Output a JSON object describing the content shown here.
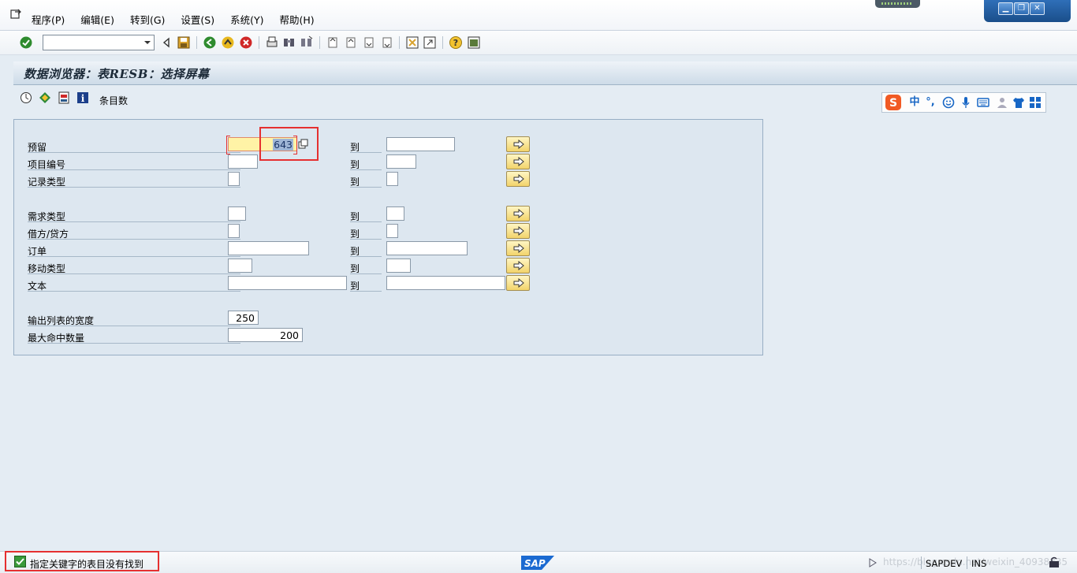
{
  "menu": {
    "items": [
      "程序(P)",
      "编辑(E)",
      "转到(G)",
      "设置(S)",
      "系统(Y)",
      "帮助(H)"
    ]
  },
  "toolbar": {
    "command_field_value": ""
  },
  "header": {
    "title": "数据浏览器：表RESB：选择屏幕"
  },
  "app_toolbar": {
    "entries_label": "条目数"
  },
  "selection": {
    "to_label": "到",
    "fields": [
      {
        "label": "预留",
        "from": "643",
        "to": ""
      },
      {
        "label": "项目编号",
        "from": "",
        "to": ""
      },
      {
        "label": "记录类型",
        "from": "",
        "to": ""
      },
      {
        "label": "需求类型",
        "from": "",
        "to": ""
      },
      {
        "label": "借方/贷方",
        "from": "",
        "to": ""
      },
      {
        "label": "订单",
        "from": "",
        "to": ""
      },
      {
        "label": "移动类型",
        "from": "",
        "to": ""
      },
      {
        "label": "文本",
        "from": "",
        "to": ""
      }
    ],
    "params": [
      {
        "label": "输出列表的宽度",
        "value": "250"
      },
      {
        "label": "最大命中数量",
        "value": "200"
      }
    ]
  },
  "status": {
    "message": "指定关键字的表目没有找到",
    "system": "SAPDEV",
    "mode": "INS",
    "watermark": "https://blog.csdn.net/weixin_40938835"
  },
  "colors": {
    "annotation": "#e53030",
    "focused_field_bg": "#fff3a6",
    "title_text": "#1c2a38"
  },
  "icons": {
    "ime": [
      "sogou-logo",
      "chinese-mode",
      "punctuation",
      "emoji",
      "microphone",
      "keyboard",
      "user",
      "skin",
      "toolbox"
    ]
  }
}
